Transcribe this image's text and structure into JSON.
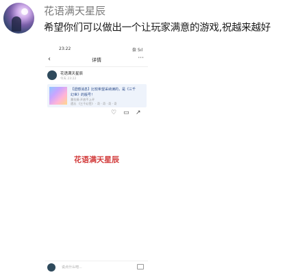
{
  "comment": {
    "username": "花语满天星辰",
    "text": "希望你们可以做出一个让玩家满意的游戏,祝越来越好"
  },
  "screenshot": {
    "status_time": "23:22",
    "status_signal": "奈 5ıl",
    "nav_back": "‹",
    "nav_title": "详情",
    "nav_more": "···",
    "post_user": "花语满天星辰",
    "post_time": "今天 23:22",
    "card_line1": "【遗憾消息】比较希望采纳谏的，是《三千",
    "card_line2": "幻世》的版号！",
    "card_line3": "番拉搞·开放不上评",
    "card_line4": "遗忘 《三千幻世》 · 奇 · 奇 · 奇 · 奇",
    "watermark": "花语满天星辰",
    "input_placeholder": "说点什么吧..."
  }
}
